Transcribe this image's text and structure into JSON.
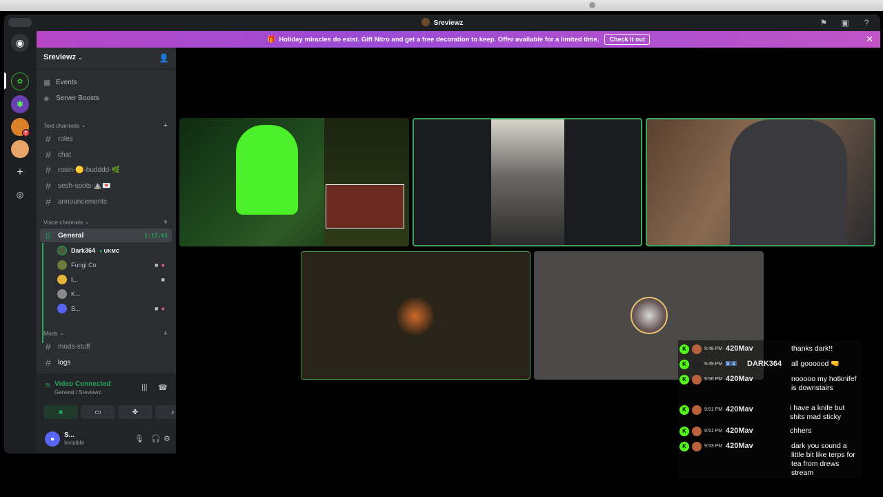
{
  "window": {
    "title": "Sreviewz"
  },
  "banner": {
    "text": "Holiday miracles do exist. Gift Nitro and get a free decoration to keep. Offer available for a limited time.",
    "cta": "Check it out"
  },
  "rail": {
    "badges": [
      "7"
    ]
  },
  "server": {
    "name": "Sreviewz",
    "nav": [
      "Events",
      "Server Boosts"
    ],
    "categories": {
      "text": "Text channels",
      "voice": "Voice channels",
      "mods": "Mods"
    },
    "text_channels": [
      "roles",
      "chat",
      "rosin-🟡-budddd-🌿",
      "sesh-spots-⛰️💌",
      "announcements"
    ],
    "voice_channel": {
      "name": "General",
      "timer": "1:17:03"
    },
    "voice_users": [
      {
        "name": "Dark364",
        "tag": "UKMC"
      },
      {
        "name": "Fungi Co"
      },
      {
        "name": "I..."
      },
      {
        "name": "K..."
      },
      {
        "name": "S..."
      }
    ],
    "mod_channels": [
      "mods-stuff",
      "logs"
    ]
  },
  "voice_panel": {
    "state": "Video Connected",
    "sub": "General / Sreviewz"
  },
  "user": {
    "name": "S...",
    "status": "Invisible"
  },
  "chat": [
    {
      "time": "9:48 PM",
      "user": "420Mav",
      "text": "thanks dark!!"
    },
    {
      "time": "9:49 PM",
      "user": "DARK364",
      "text": "all goooood 🤜"
    },
    {
      "time": "9:50 PM",
      "user": "420Mav",
      "text": "nooooo my hotknifef is downstairs"
    },
    {
      "time": "9:51 PM",
      "user": "420Mav",
      "text": "i have a knife but shits mad sticky"
    },
    {
      "time": "9:51 PM",
      "user": "420Mav",
      "text": "chhers"
    },
    {
      "time": "9:53 PM",
      "user": "420Mav",
      "text": "dark you sound a little bit like terps for tea from drews stream"
    }
  ]
}
